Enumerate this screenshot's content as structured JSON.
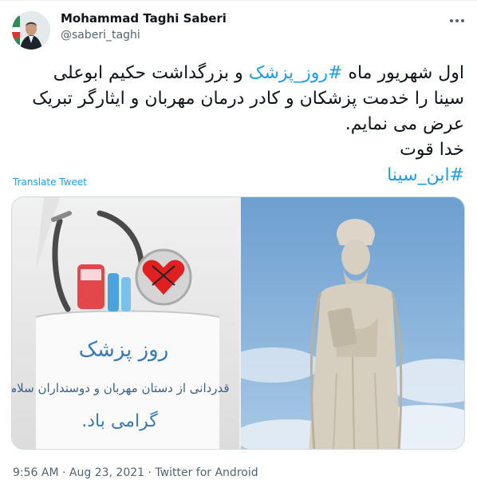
{
  "author": {
    "display_name": "Mohammad Taghi Saberi",
    "handle": "@saberi_taghi",
    "avatar_icon": "profile-photo"
  },
  "tweet": {
    "line1": {
      "prefix": "اول شهریور ماه ",
      "hashtag": "#روز_پزشک",
      "suffix": " و بزرگداشت حکیم ابوعلی"
    },
    "line2": "سینا را خدمت پزشکان و کادر درمان مهربان و ایثارگر تبریک",
    "line3": "عرض می نمایم.",
    "line4": "خدا قوت",
    "line5_hashtag": "#ابن_سینا"
  },
  "translate_label": "Translate Tweet",
  "media": {
    "left_card": {
      "title": "روز پزشک",
      "subtitle": "قدردانی از دستان مهربان و دوستداران سلامت",
      "closing": "گرامی باد."
    }
  },
  "meta": {
    "time": "9:56 AM",
    "separator": " · ",
    "date": "Aug 23, 2021",
    "source": "Twitter for Android"
  },
  "colors": {
    "link": "#1d9bf0",
    "secondary_text": "#536471",
    "primary_text": "#0f1419"
  }
}
